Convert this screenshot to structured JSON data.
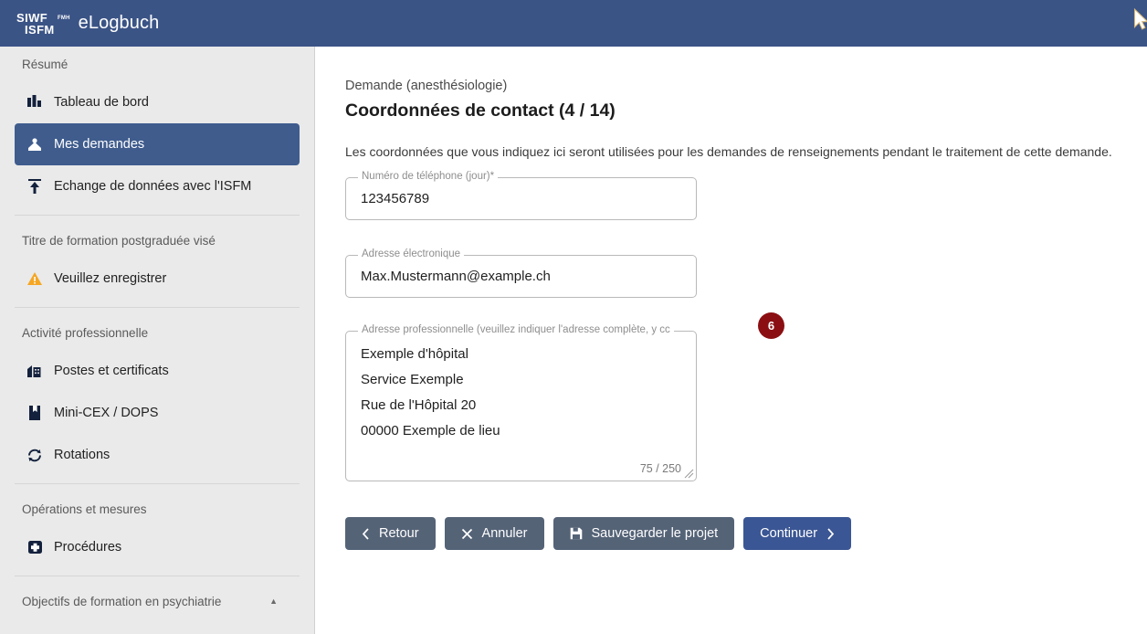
{
  "header": {
    "logo_line1": "SIWF",
    "logo_line2": "ISFM",
    "logo_superscript": "FMH",
    "app_title": "eLogbuch",
    "background_color": "#3b5486",
    "cursor_icon": "mouse-pointer-icon"
  },
  "sidebar": {
    "background_color": "#eaeaea",
    "active_color": "#3f5c8d",
    "groups": [
      {
        "heading": "Résumé",
        "collapsible": false,
        "items": [
          {
            "label": "Tableau de bord",
            "icon": "dashboard-icon",
            "active": false
          },
          {
            "label": "Mes demandes",
            "icon": "inbox-icon",
            "active": true
          },
          {
            "label": "Echange de données avec l'ISFM",
            "icon": "upload-icon",
            "active": false
          }
        ]
      },
      {
        "heading": "Titre de formation postgraduée visé",
        "collapsible": false,
        "items": [
          {
            "label": "Veuillez enregistrer",
            "icon": "warning-triangle-icon",
            "active": false
          }
        ]
      },
      {
        "heading": "Activité professionnelle",
        "collapsible": false,
        "items": [
          {
            "label": "Postes et certificats",
            "icon": "hospital-icon",
            "active": false
          },
          {
            "label": "Mini-CEX / DOPS",
            "icon": "bookmark-icon",
            "active": false
          },
          {
            "label": "Rotations",
            "icon": "refresh-icon",
            "active": false
          }
        ]
      },
      {
        "heading": "Opérations et mesures",
        "collapsible": false,
        "items": [
          {
            "label": "Procédures",
            "icon": "medical-cross-icon",
            "active": false
          }
        ]
      },
      {
        "heading": "Objectifs de formation en psychiatrie",
        "collapsible": true,
        "caret": "▲",
        "items": []
      }
    ]
  },
  "main": {
    "breadcrumb": "Demande (anesthésiologie)",
    "title": "Coordonnées de contact (4 / 14)",
    "intro": "Les coordonnées que vous indiquez ici seront utilisées pour les demandes de renseignements pendant le traitement de cette demande.",
    "fields": {
      "phone": {
        "label": "Numéro de téléphone (jour)*",
        "value": "123456789",
        "required": true
      },
      "email": {
        "label": "Adresse électronique",
        "value": "Max.Mustermann@example.ch",
        "required": false
      },
      "address": {
        "label": "Adresse professionnelle (veuillez indiquer l'adresse complète, y cc",
        "lines": [
          "Exemple d'hôpital",
          "Service Exemple",
          "Rue de l'Hôpital 20",
          "00000 Exemple de lieu"
        ],
        "char_count": "75 / 250"
      }
    },
    "badge": {
      "text": "6",
      "color": "#8b0f12"
    },
    "buttons": [
      {
        "label": "Retour",
        "icon": "chevron-left-icon",
        "icon_position": "left",
        "primary": false
      },
      {
        "label": "Annuler",
        "icon": "close-x-icon",
        "icon_position": "left",
        "primary": false
      },
      {
        "label": "Sauvegarder le projet",
        "icon": "save-floppy-icon",
        "icon_position": "left",
        "primary": false
      },
      {
        "label": "Continuer",
        "icon": "chevron-right-icon",
        "icon_position": "right",
        "primary": true
      }
    ]
  }
}
